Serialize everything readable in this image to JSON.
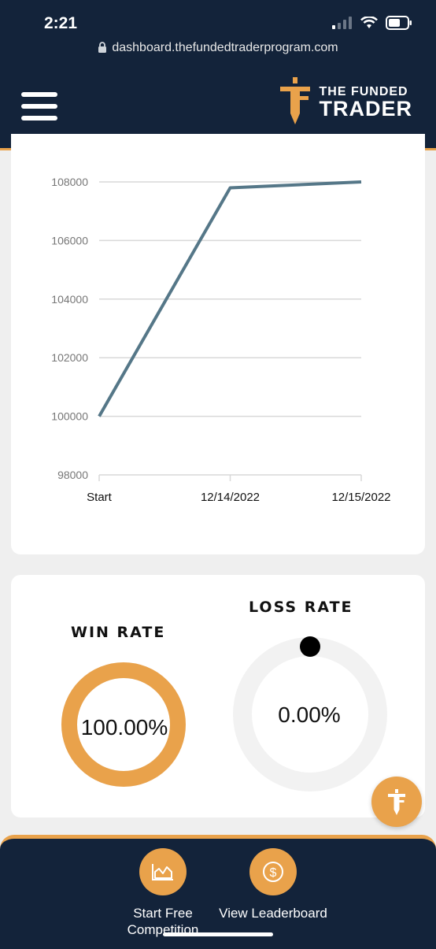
{
  "status": {
    "time": "2:21",
    "url": "dashboard.thefundedtraderprogram.com"
  },
  "brand": {
    "line1": "THE FUNDED",
    "line2": "TRADER",
    "accent": "#e9a24b",
    "navy": "#13233a"
  },
  "icons": {
    "menu": "hamburger-icon",
    "lock": "lock-icon",
    "fab": "logo-icon",
    "chart": "area-chart-icon",
    "dollar": "dollar-coin-icon"
  },
  "chart_data": {
    "type": "line",
    "categories": [
      "Start",
      "12/14/2022",
      "12/15/2022"
    ],
    "values": [
      100000,
      107800,
      108000
    ],
    "yticks": [
      "98000",
      "100000",
      "102000",
      "104000",
      "106000",
      "108000"
    ],
    "ylim": [
      98000,
      108000
    ],
    "grid": true,
    "line_color": "#557788"
  },
  "rates": {
    "win": {
      "title": "WIN RATE",
      "value": "100.00%",
      "fraction": 1.0,
      "color": "#e9a24b"
    },
    "loss": {
      "title": "LOSS RATE",
      "value": "0.00%",
      "fraction": 0.0,
      "color": "#f2f2f2"
    }
  },
  "bottom_nav": [
    {
      "label": "Start Free Competition"
    },
    {
      "label": "View Leaderboard"
    }
  ]
}
